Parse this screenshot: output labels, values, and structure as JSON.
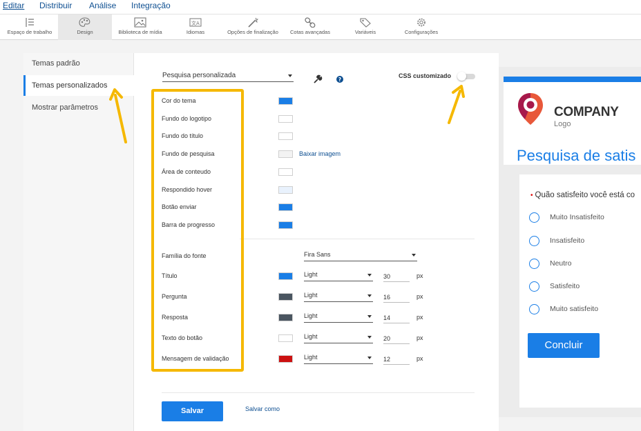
{
  "menu": [
    "Editar",
    "Distribuir",
    "Análise",
    "Integração"
  ],
  "toolbar": [
    {
      "label": "Espaço de trabalho",
      "icon": "workspace-icon"
    },
    {
      "label": "Design",
      "icon": "palette-icon"
    },
    {
      "label": "Biblioteca de mídia",
      "icon": "image-icon"
    },
    {
      "label": "Idiomas",
      "icon": "translate-icon"
    },
    {
      "label": "Opções de finalização",
      "icon": "wand-icon"
    },
    {
      "label": "Cotas avançadas",
      "icon": "link-icon"
    },
    {
      "label": "Variáveis",
      "icon": "tag-icon"
    },
    {
      "label": "Configurações",
      "icon": "gear-icon"
    }
  ],
  "sidebar": [
    "Temas padrão",
    "Temas personalizados",
    "Mostrar parâmetros"
  ],
  "theme": {
    "selected": "Pesquisa personalizada",
    "css_label": "CSS customizado",
    "download_image": "Baixar imagem"
  },
  "colors": [
    {
      "label": "Cor do tema",
      "color": "#1a7ee6"
    },
    {
      "label": "Fundo do logotipo",
      "color": "#ffffff"
    },
    {
      "label": "Fundo do título",
      "color": "#ffffff"
    },
    {
      "label": "Fundo de pesquisa",
      "color": "#f3f3f3"
    },
    {
      "label": "Área de conteudo",
      "color": "#ffffff"
    },
    {
      "label": "Respondido hover",
      "color": "#e9f2fd"
    },
    {
      "label": "Botão enviar",
      "color": "#1a7ee6"
    },
    {
      "label": "Barra de progresso",
      "color": "#1a7ee6"
    }
  ],
  "font": {
    "family_label": "Família do fonte",
    "family_value": "Fira Sans",
    "rows": [
      {
        "label": "Título",
        "color": "#1a7ee6",
        "weight": "Light",
        "size": "30",
        "unit": "px"
      },
      {
        "label": "Pergunta",
        "color": "#4a5560",
        "weight": "Light",
        "size": "16",
        "unit": "px"
      },
      {
        "label": "Resposta",
        "color": "#4a5560",
        "weight": "Light",
        "size": "14",
        "unit": "px"
      },
      {
        "label": "Texto do botão",
        "color": "#ffffff",
        "weight": "Light",
        "size": "20",
        "unit": "px"
      },
      {
        "label": "Mensagem de validação",
        "color": "#cc1111",
        "weight": "Light",
        "size": "12",
        "unit": "px"
      }
    ]
  },
  "actions": {
    "save": "Salvar",
    "save_as": "Salvar como"
  },
  "preview": {
    "company": "COMPANY",
    "logo": "Logo",
    "title": "Pesquisa de satis",
    "question": "Quão satisfeito você está co",
    "options": [
      "Muito Insatisfeito",
      "Insatisfeito",
      "Neutro",
      "Satisfeito",
      "Muito satisfeito"
    ],
    "button": "Concluir"
  },
  "accent": "#1a7ee6",
  "highlight_color": "#f5b800"
}
